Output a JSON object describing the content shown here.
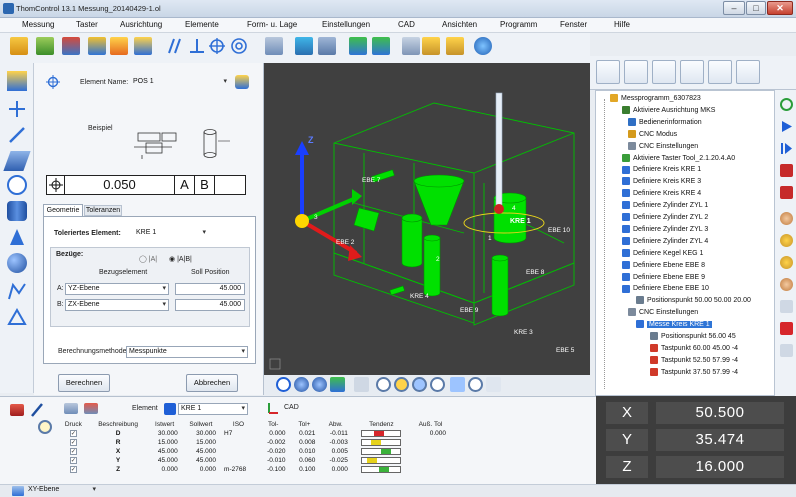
{
  "title": "ThomControl 13.1  Messung_20140429-1.ol",
  "menu": [
    "Messung",
    "Taster",
    "Ausrichtung",
    "Elemente",
    "Form- u. Lage",
    "Einstellungen",
    "CAD",
    "Ansichten",
    "Programm",
    "Fenster",
    "Hilfe"
  ],
  "panel": {
    "element_name_label": "Element Name:",
    "element_name_value": "POS 1",
    "example_label": "Beispiel",
    "fcf_value": "0.050",
    "fcf_ref_a": "A",
    "fcf_ref_b": "B",
    "tabs": [
      "Geometrie",
      "Toleranzen"
    ],
    "tol_element_label": "Toleriertes Element:",
    "tol_element_value": "KRE 1",
    "bezuege_label": "Bezüge:",
    "radio_a": "|A|",
    "radio_ab": "|A|B|",
    "col_bezug": "Bezugselement",
    "col_soll": "Soll Position",
    "ref_a_label": "A:",
    "ref_a_value": "YZ-Ebene",
    "ref_a_pos": "45.000",
    "ref_b_label": "B:",
    "ref_b_value": "ZX-Ebene",
    "ref_b_pos": "45.000",
    "method_label": "Berechnungsmethode:",
    "method_value": "Messpunkte",
    "calc_button": "Berechnen",
    "cancel_button": "Abbrechen"
  },
  "viewport_labels": {
    "ebe7": "EBE 7",
    "ebe2": "EBE 2",
    "ebe10": "EBE 10",
    "ebe8": "EBE 8",
    "ebe9": "EBE 9",
    "ebe5": "EBE 5",
    "kre1": "KRE 1",
    "kre3": "KRE 3",
    "kre4": "KRE 4",
    "n1": "1",
    "n2": "2",
    "n3": "3",
    "n4": "4"
  },
  "tree": [
    {
      "label": "Messprogramm_6307823",
      "icon": "folder-icon",
      "color": "#e2a726"
    },
    {
      "label": "Aktiviere Ausrichtung MKS",
      "icon": "alignment-icon",
      "color": "#3a7d2f"
    },
    {
      "label": "Bedienerinformation",
      "icon": "info-icon",
      "color": "#2f6fc4"
    },
    {
      "label": "CNC Modus",
      "icon": "cnc-icon",
      "color": "#d49a1c"
    },
    {
      "label": "CNC Einstellungen",
      "icon": "cnc-settings-icon",
      "color": "#7c8a9c"
    },
    {
      "label": "Aktiviere Taster Tool_2.1.20.4.A0",
      "icon": "probe-icon",
      "color": "#3a9d3a"
    },
    {
      "label": "Definiere Kreis KRE 1",
      "icon": "circle-icon",
      "color": "#2f6fd6"
    },
    {
      "label": "Definiere Kreis KRE 3",
      "icon": "circle-icon",
      "color": "#2f6fd6"
    },
    {
      "label": "Definiere Kreis KRE 4",
      "icon": "circle-icon",
      "color": "#2f6fd6"
    },
    {
      "label": "Definiere Zylinder ZYL 1",
      "icon": "cylinder-icon",
      "color": "#2f6fd6"
    },
    {
      "label": "Definiere Zylinder ZYL 2",
      "icon": "cylinder-icon",
      "color": "#2f6fd6"
    },
    {
      "label": "Definiere Zylinder ZYL 3",
      "icon": "cylinder-icon",
      "color": "#2f6fd6"
    },
    {
      "label": "Definiere Zylinder ZYL 4",
      "icon": "cylinder-icon",
      "color": "#2f6fd6"
    },
    {
      "label": "Definiere Kegel KEG 1",
      "icon": "cone-icon",
      "color": "#2f6fd6"
    },
    {
      "label": "Definiere Ebene EBE 8",
      "icon": "plane-icon",
      "color": "#2f6fd6"
    },
    {
      "label": "Definiere Ebene EBE 9",
      "icon": "plane-icon",
      "color": "#2f6fd6"
    },
    {
      "label": "Definiere Ebene EBE 10",
      "icon": "plane-icon",
      "color": "#2f6fd6"
    },
    {
      "label": "Positionspunkt 50.00 50.00 20.00",
      "icon": "position-point-icon",
      "color": "#6a7c8f"
    },
    {
      "label": "CNC Einstellungen",
      "icon": "cnc-settings-icon",
      "color": "#7c8a9c"
    },
    {
      "label": "Messe Kreis KRE 1",
      "icon": "circle-icon",
      "color": "#2f6fd6",
      "selected": true
    },
    {
      "label": "Positionspunkt 56.00 45",
      "icon": "position-point-icon",
      "color": "#6a7c8f"
    },
    {
      "label": "Tastpunkt 60.00 45.00 -4",
      "icon": "touch-point-icon",
      "color": "#d03a2a"
    },
    {
      "label": "Tastpunkt 52.50 57.99 -4",
      "icon": "touch-point-icon",
      "color": "#d03a2a"
    },
    {
      "label": "Tastpunkt 37.50 57.99 -4",
      "icon": "touch-point-icon",
      "color": "#d03a2a"
    }
  ],
  "bottom": {
    "element_label": "Element",
    "element_value": "KRE 1",
    "cad_label": "CAD",
    "headers": [
      "Druck",
      "Beschreibung",
      "Istwert",
      "Sollwert",
      "ISO",
      "Tol-",
      "Tol+",
      "Abw.",
      "Tendenz",
      "Auß. Tol"
    ],
    "rows": [
      {
        "desc": "D",
        "ist": "30.000",
        "soll": "30.000",
        "iso": "H7",
        "tolm": "0.000",
        "tolp": "0.021",
        "abw": "-0.011",
        "ausstol": "0.000",
        "tend_color": "#d6262b",
        "tend_pos": 0.35
      },
      {
        "desc": "R",
        "ist": "15.000",
        "soll": "15.000",
        "iso": "",
        "tolm": "-0.002",
        "tolp": "0.008",
        "abw": "-0.003",
        "ausstol": "",
        "tend_color": "#e6d21c",
        "tend_pos": 0.25
      },
      {
        "desc": "X",
        "ist": "45.000",
        "soll": "45.000",
        "iso": "",
        "tolm": "-0.020",
        "tolp": "0.010",
        "abw": "0.005",
        "ausstol": "",
        "tend_color": "#3bb23b",
        "tend_pos": 0.55
      },
      {
        "desc": "Y",
        "ist": "45.000",
        "soll": "45.000",
        "iso": "",
        "tolm": "-0.010",
        "tolp": "0.060",
        "abw": "-0.025",
        "ausstol": "",
        "tend_color": "#e6d21c",
        "tend_pos": 0.15
      },
      {
        "desc": "Z",
        "ist": "0.000",
        "soll": "0.000",
        "iso": "m-2768",
        "tolm": "-0.100",
        "tolp": "0.100",
        "abw": "0.000",
        "ausstol": "",
        "tend_color": "#3bb23b",
        "tend_pos": 0.5
      }
    ]
  },
  "dro": [
    {
      "axis": "X",
      "value": "50.500"
    },
    {
      "axis": "Y",
      "value": "35.474"
    },
    {
      "axis": "Z",
      "value": "16.000"
    }
  ],
  "status": {
    "plane_value": "XY-Ebene"
  },
  "colors": {
    "accent": "#2f75d6",
    "dro_bg": "#3d3d3d",
    "viewport_bg": "#404040",
    "cad_green": "#00e000"
  }
}
